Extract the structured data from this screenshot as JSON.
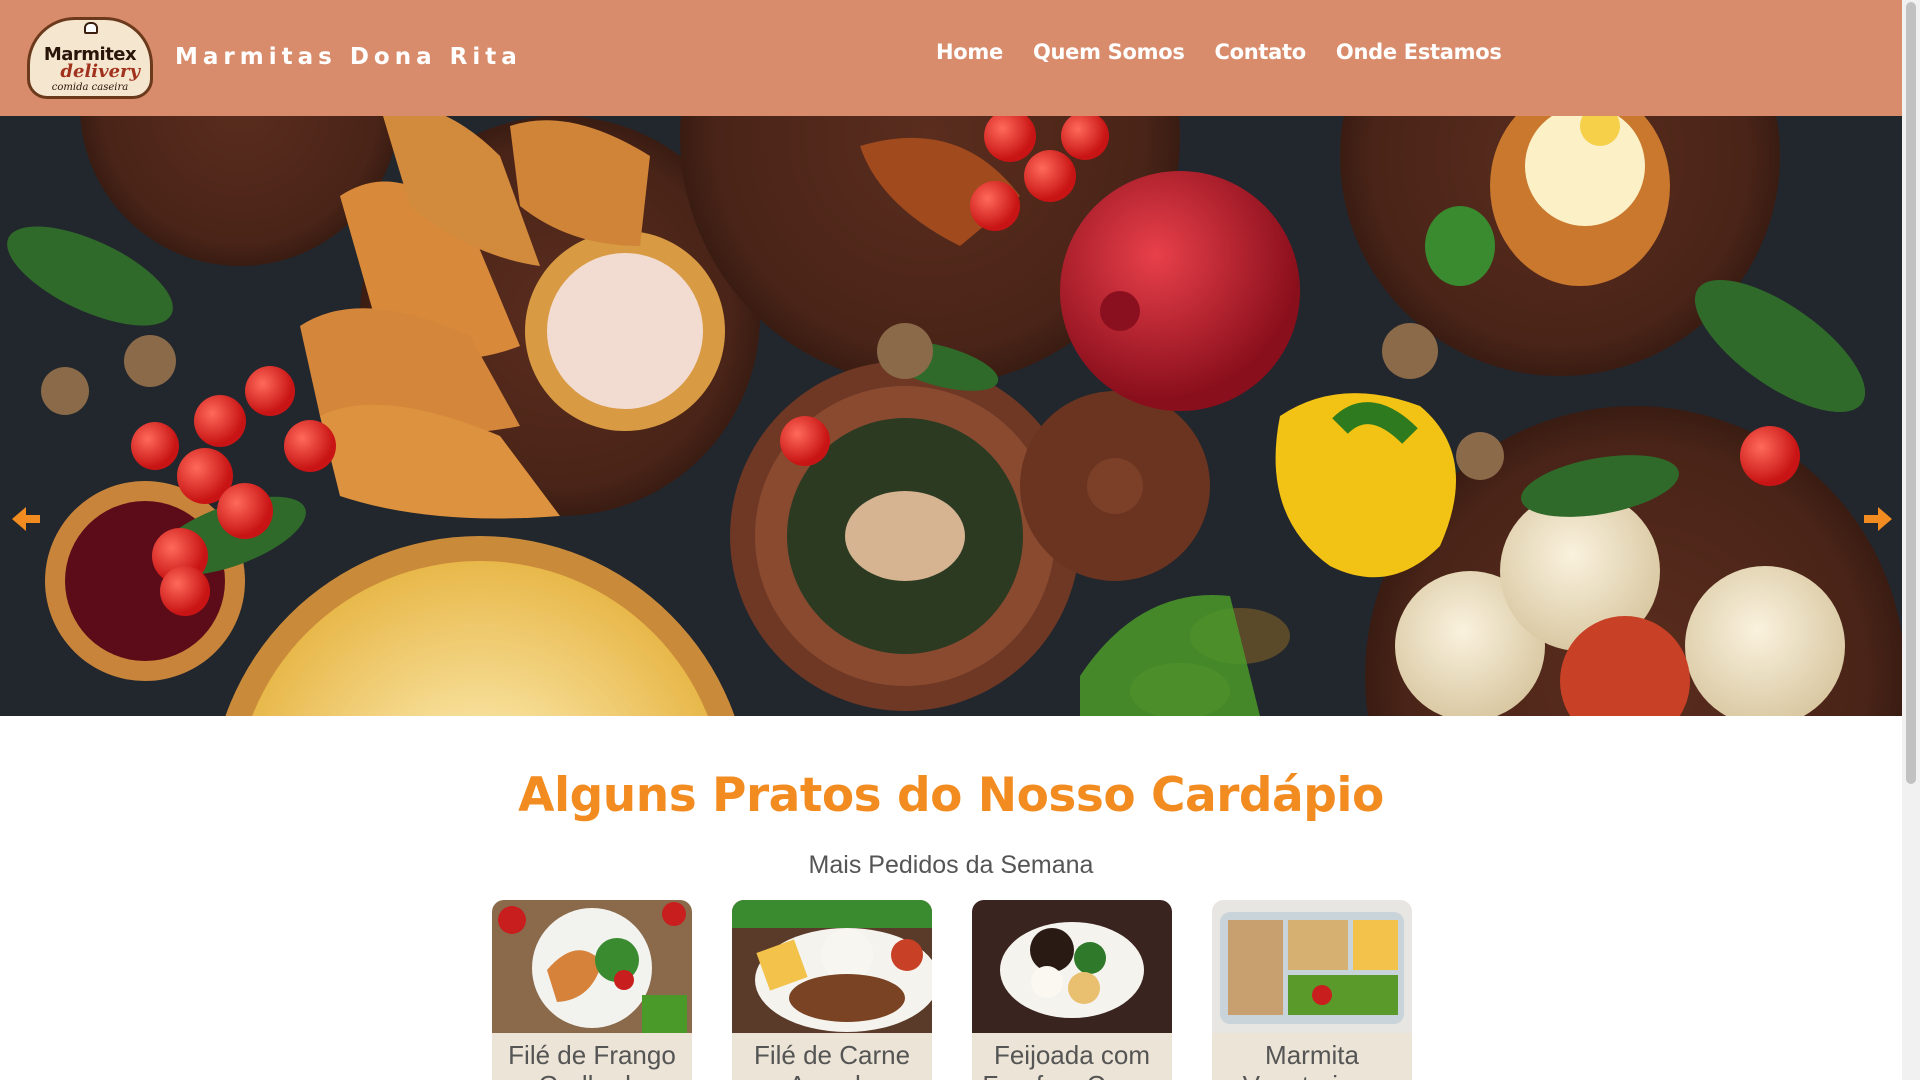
{
  "header": {
    "logo": {
      "line1": "Marmitex",
      "line2": "delivery",
      "line3": "comida caseira"
    },
    "brand": "Marmitas Dona Rita",
    "nav": [
      "Home",
      "Quem Somos",
      "Contato",
      "Onde Estamos"
    ]
  },
  "hero": {
    "prev_icon": "arrow-left-icon",
    "next_icon": "arrow-right-icon",
    "accent_color": "#f28c20"
  },
  "section": {
    "title": "Alguns Pratos do Nosso Cardápio",
    "subtitle": "Mais Pedidos da Semana"
  },
  "dishes": [
    {
      "name": "Filé de Frango Grelhado"
    },
    {
      "name": "Filé de Carne Assada"
    },
    {
      "name": "Feijoada com Farofa e Couve"
    },
    {
      "name": "Marmita Vegetariana com"
    }
  ],
  "colors": {
    "header_bg": "#d98c6b",
    "title": "#f28c20",
    "card_bg": "#ece4d6"
  }
}
